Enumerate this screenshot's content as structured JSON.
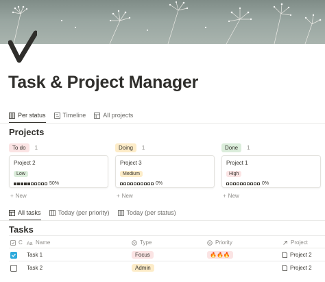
{
  "page": {
    "title": "Task & Project Manager",
    "icon": "checkmark-icon"
  },
  "top_tabs": [
    {
      "label": "Per status",
      "icon": "board-icon",
      "active": true
    },
    {
      "label": "Timeline",
      "icon": "timeline-icon",
      "active": false
    },
    {
      "label": "All projects",
      "icon": "table-icon",
      "active": false
    }
  ],
  "projects_section": {
    "title": "Projects",
    "columns": [
      {
        "status": "To do",
        "count": "1",
        "pill_color": "#fbe4e4",
        "card": {
          "title": "Project 2",
          "tag": "Low",
          "tag_bg": "#dbeddb",
          "progress_filled": 5,
          "progress_total": 10,
          "progress_label": "50%"
        },
        "new_label": "New"
      },
      {
        "status": "Doing",
        "count": "1",
        "pill_color": "#fdecc8",
        "card": {
          "title": "Project 3",
          "tag": "Medium",
          "tag_bg": "#fdecc8",
          "progress_filled": 0,
          "progress_total": 10,
          "progress_label": "0%"
        },
        "new_label": "New"
      },
      {
        "status": "Done",
        "count": "1",
        "pill_color": "#dbeddb",
        "card": {
          "title": "Project 1",
          "tag": "High",
          "tag_bg": "#fbe4e4",
          "progress_filled": 0,
          "progress_total": 10,
          "progress_label": "0%"
        },
        "new_label": "New"
      }
    ]
  },
  "task_tabs": [
    {
      "label": "All tasks",
      "icon": "table-icon",
      "active": true
    },
    {
      "label": "Today (per priority)",
      "icon": "board-icon",
      "active": false
    },
    {
      "label": "Today (per status)",
      "icon": "board-icon",
      "active": false
    }
  ],
  "tasks_section": {
    "title": "Tasks",
    "headers": {
      "check": "C",
      "name": "Name",
      "type": "Type",
      "priority": "Priority",
      "project": "Project"
    },
    "rows": [
      {
        "checked": true,
        "name": "Task 1",
        "type": "Focus",
        "type_bg": "#fbe4e4",
        "priority": "🔥🔥🔥",
        "project": "Project 2"
      },
      {
        "checked": false,
        "name": "Task 2",
        "type": "Admin",
        "type_bg": "#fdecc8",
        "priority": "",
        "project": "Project 2"
      }
    ]
  }
}
